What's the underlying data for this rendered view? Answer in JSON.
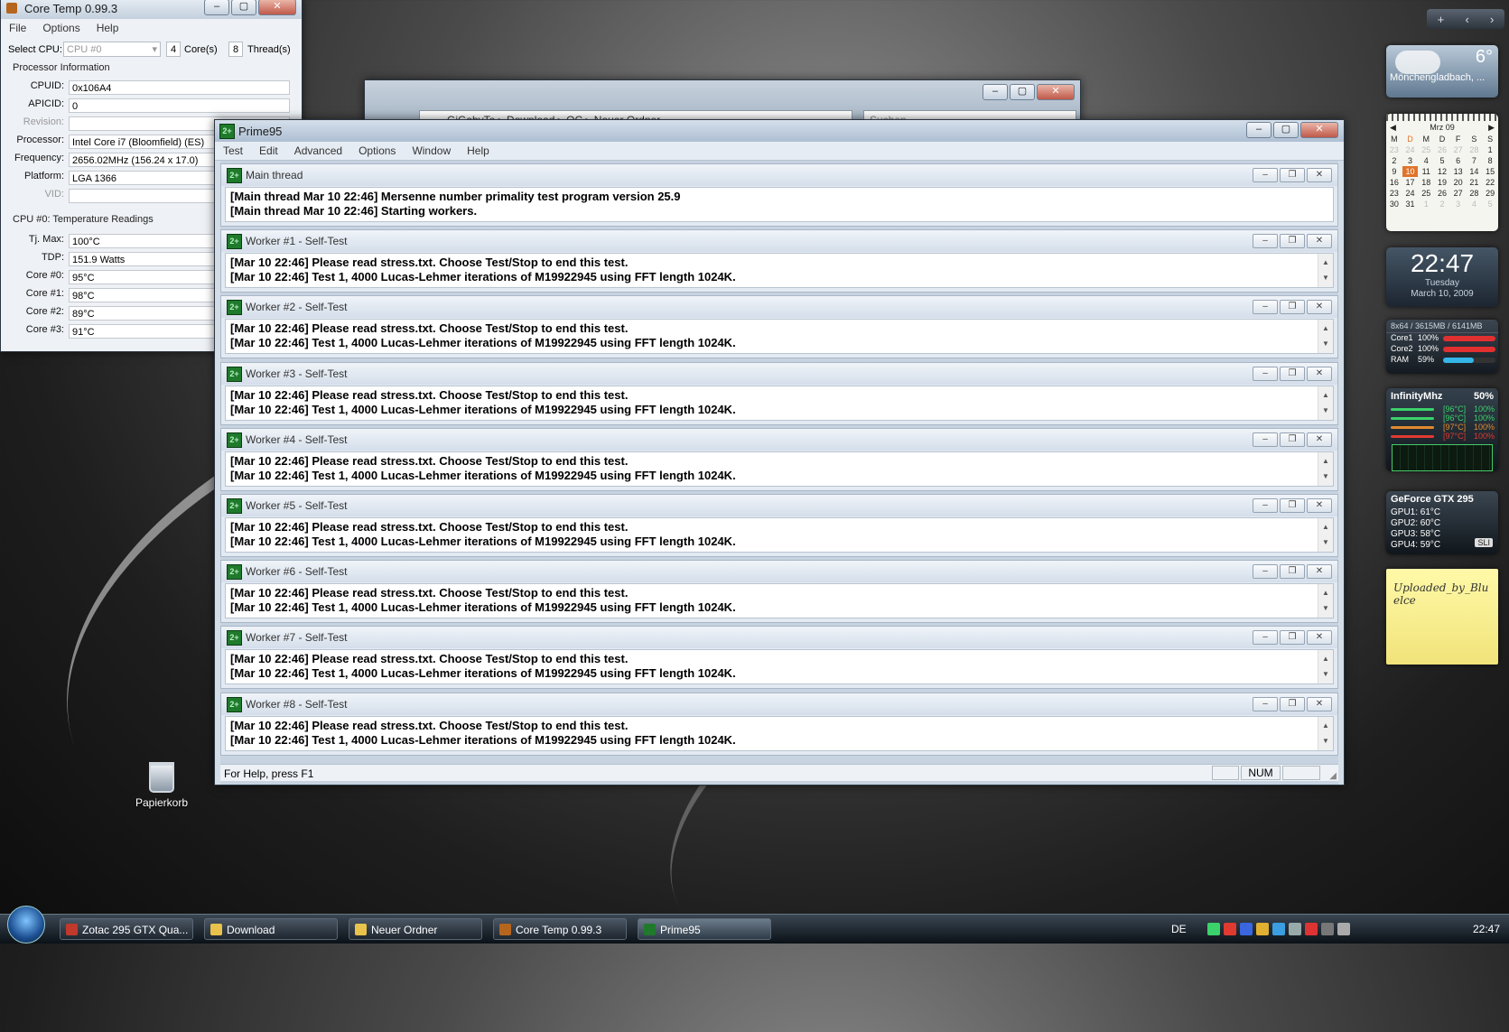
{
  "coretemp": {
    "title": "Core Temp 0.99.3",
    "menu": [
      "File",
      "Options",
      "Help"
    ],
    "select_cpu_label": "Select CPU:",
    "select_cpu_value": "CPU #0",
    "cores_count": "4",
    "cores_label": "Core(s)",
    "threads_count": "8",
    "threads_label": "Thread(s)",
    "proc_info_title": "Processor Information",
    "fields": [
      {
        "label": "CPUID:",
        "value": "0x106A4"
      },
      {
        "label": "APICID:",
        "value": "0"
      },
      {
        "label": "Revision:",
        "value": ""
      },
      {
        "label": "Processor:",
        "value": "Intel Core i7 (Bloomfield) (ES)"
      },
      {
        "label": "Frequency:",
        "value": "2656.02MHz (156.24 x 17.0)"
      },
      {
        "label": "Platform:",
        "value": "LGA 1366"
      },
      {
        "label": "VID:",
        "value": ""
      }
    ],
    "temp_title": "CPU #0: Temperature Readings",
    "temps": [
      {
        "label": "Tj. Max:",
        "value": "100°C"
      },
      {
        "label": "TDP:",
        "value": "151.9 Watts"
      },
      {
        "label": "Core #0:",
        "value": "95°C"
      },
      {
        "label": "Core #1:",
        "value": "98°C"
      },
      {
        "label": "Core #2:",
        "value": "89°C"
      },
      {
        "label": "Core #3:",
        "value": "91°C"
      }
    ]
  },
  "explorer": {
    "address": "GiGabyTe  ▸  Download  ▸  OC  ▸  Neuer Ordner",
    "search_placeholder": "Suchen"
  },
  "prime95": {
    "title": "Prime95",
    "menu": [
      "Test",
      "Edit",
      "Advanced",
      "Options",
      "Window",
      "Help"
    ],
    "windows": [
      {
        "title": "Main thread",
        "lines": [
          "[Main thread Mar 10 22:46] Mersenne number primality test program version 25.9",
          "[Main thread Mar 10 22:46] Starting workers."
        ]
      },
      {
        "title": "Worker #1 - Self-Test",
        "lines": [
          "[Mar 10 22:46] Please read stress.txt.  Choose Test/Stop to end this test.",
          "[Mar 10 22:46] Test 1, 4000 Lucas-Lehmer iterations of M19922945 using FFT length 1024K."
        ]
      },
      {
        "title": "Worker #2 - Self-Test",
        "lines": [
          "[Mar 10 22:46] Please read stress.txt.  Choose Test/Stop to end this test.",
          "[Mar 10 22:46] Test 1, 4000 Lucas-Lehmer iterations of M19922945 using FFT length 1024K."
        ]
      },
      {
        "title": "Worker #3 - Self-Test",
        "lines": [
          "[Mar 10 22:46] Please read stress.txt.  Choose Test/Stop to end this test.",
          "[Mar 10 22:46] Test 1, 4000 Lucas-Lehmer iterations of M19922945 using FFT length 1024K."
        ]
      },
      {
        "title": "Worker #4 - Self-Test",
        "lines": [
          "[Mar 10 22:46] Please read stress.txt.  Choose Test/Stop to end this test.",
          "[Mar 10 22:46] Test 1, 4000 Lucas-Lehmer iterations of M19922945 using FFT length 1024K."
        ]
      },
      {
        "title": "Worker #5 - Self-Test",
        "lines": [
          "[Mar 10 22:46] Please read stress.txt.  Choose Test/Stop to end this test.",
          "[Mar 10 22:46] Test 1, 4000 Lucas-Lehmer iterations of M19922945 using FFT length 1024K."
        ]
      },
      {
        "title": "Worker #6 - Self-Test",
        "lines": [
          "[Mar 10 22:46] Please read stress.txt.  Choose Test/Stop to end this test.",
          "[Mar 10 22:46] Test 1, 4000 Lucas-Lehmer iterations of M19922945 using FFT length 1024K."
        ]
      },
      {
        "title": "Worker #7 - Self-Test",
        "lines": [
          "[Mar 10 22:46] Please read stress.txt.  Choose Test/Stop to end this test.",
          "[Mar 10 22:46] Test 1, 4000 Lucas-Lehmer iterations of M19922945 using FFT length 1024K."
        ]
      },
      {
        "title": "Worker #8 - Self-Test",
        "lines": [
          "[Mar 10 22:46] Please read stress.txt.  Choose Test/Stop to end this test.",
          "[Mar 10 22:46] Test 1, 4000 Lucas-Lehmer iterations of M19922945 using FFT length 1024K."
        ]
      }
    ],
    "status_text": "For Help, press F1",
    "status_num": "NUM"
  },
  "desktop": {
    "recycle_label": "Papierkorb"
  },
  "sidebar": {
    "weather": {
      "temp": "6°",
      "city": "Mönchengladbach, ..."
    },
    "calendar": {
      "month": "Mrz 09",
      "weekdays": [
        "M",
        "D",
        "M",
        "D",
        "F",
        "S",
        "S"
      ],
      "weeks": [
        [
          [
            "23",
            "o"
          ],
          [
            "24",
            "o"
          ],
          [
            "25",
            "o"
          ],
          [
            "26",
            "o"
          ],
          [
            "27",
            "o"
          ],
          [
            "28",
            "o"
          ],
          [
            "1",
            ""
          ]
        ],
        [
          [
            "2",
            ""
          ],
          [
            "3",
            ""
          ],
          [
            "4",
            ""
          ],
          [
            "5",
            ""
          ],
          [
            "6",
            ""
          ],
          [
            "7",
            ""
          ],
          [
            "8",
            ""
          ]
        ],
        [
          [
            "9",
            ""
          ],
          [
            "10",
            "today"
          ],
          [
            "11",
            ""
          ],
          [
            "12",
            ""
          ],
          [
            "13",
            ""
          ],
          [
            "14",
            ""
          ],
          [
            "15",
            ""
          ]
        ],
        [
          [
            "16",
            ""
          ],
          [
            "17",
            ""
          ],
          [
            "18",
            ""
          ],
          [
            "19",
            ""
          ],
          [
            "20",
            ""
          ],
          [
            "21",
            ""
          ],
          [
            "22",
            ""
          ]
        ],
        [
          [
            "23",
            ""
          ],
          [
            "24",
            ""
          ],
          [
            "25",
            ""
          ],
          [
            "26",
            ""
          ],
          [
            "27",
            ""
          ],
          [
            "28",
            ""
          ],
          [
            "29",
            ""
          ]
        ],
        [
          [
            "30",
            ""
          ],
          [
            "31",
            ""
          ],
          [
            "1",
            "o"
          ],
          [
            "2",
            "o"
          ],
          [
            "3",
            "o"
          ],
          [
            "4",
            "o"
          ],
          [
            "5",
            "o"
          ]
        ]
      ]
    },
    "clock": {
      "time": "22:47",
      "day": "Tuesday",
      "date": "March 10, 2009"
    },
    "cpumeter": {
      "header": "8x64 / 3615MB / 6141MB",
      "rows": [
        {
          "label": "Core1",
          "pct": "100%",
          "level": 1.0,
          "color": "#e03030"
        },
        {
          "label": "Core2",
          "pct": "100%",
          "level": 1.0,
          "color": "#e03030"
        },
        {
          "label": "RAM",
          "pct": "59%",
          "level": 0.59,
          "color": "#35b6e8"
        }
      ]
    },
    "infinity": {
      "title": "InfinityMhz",
      "load": "50%",
      "rows": [
        {
          "temp": "[96°C]",
          "pct": "100%",
          "color": "#3bd16b"
        },
        {
          "temp": "[96°C]",
          "pct": "100%",
          "color": "#3bd16b"
        },
        {
          "temp": "[97°C]",
          "pct": "100%",
          "color": "#e08a30"
        },
        {
          "temp": "[97°C]",
          "pct": "100%",
          "color": "#e03a30"
        }
      ]
    },
    "gpu": {
      "title": "GeForce GTX 295",
      "lines": [
        "GPU1: 61°C",
        "GPU2: 60°C",
        "GPU3: 58°C",
        "GPU4: 59°C"
      ],
      "badge": "SLI"
    },
    "note": {
      "text": "Uploaded_by_Bluelce"
    }
  },
  "taskbar": {
    "buttons": [
      {
        "label": "Zotac 295 GTX Qua...",
        "color": "#c0392b"
      },
      {
        "label": "Download",
        "color": "#e8c24a"
      },
      {
        "label": "Neuer Ordner",
        "color": "#e8c24a"
      },
      {
        "label": "Core Temp 0.99.3",
        "color": "#b5651d"
      },
      {
        "label": "Prime95",
        "color": "#1f7a2c"
      }
    ],
    "lang": "DE",
    "clock": "22:47"
  }
}
